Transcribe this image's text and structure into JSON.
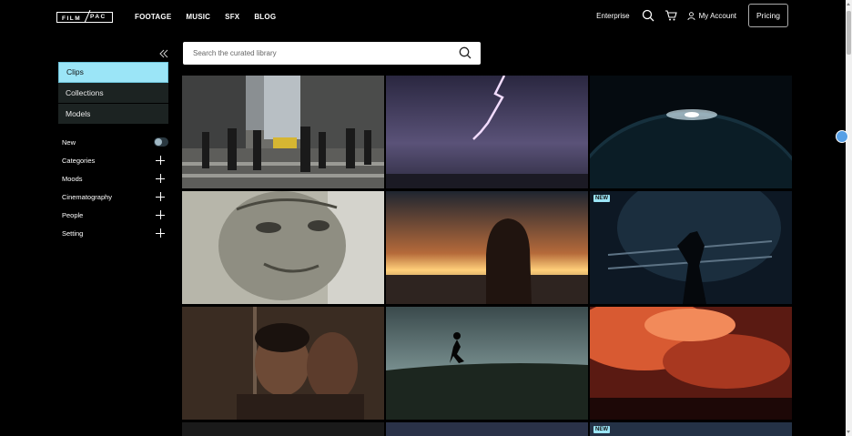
{
  "header": {
    "logo_text": "FILMPAC",
    "nav": [
      "FOOTAGE",
      "MUSIC",
      "SFX",
      "BLOG"
    ],
    "enterprise": "Enterprise",
    "account": "My Account",
    "pricing": "Pricing",
    "icons": [
      "search-icon",
      "cart-icon",
      "user-icon"
    ]
  },
  "sidebar": {
    "tabs": [
      "Clips",
      "Collections",
      "Models"
    ],
    "active_tab": "Clips",
    "new_label": "New",
    "filters": [
      "Categories",
      "Moods",
      "Cinematography",
      "People",
      "Setting"
    ]
  },
  "search": {
    "placeholder": "Search the curated library"
  },
  "grid": {
    "tiles": [
      {
        "name": "city-crosswalk-clip",
        "badge": ""
      },
      {
        "name": "lightning-storm-clip",
        "badge": ""
      },
      {
        "name": "planet-horizon-clip",
        "badge": ""
      },
      {
        "name": "dollar-bill-portrait-clip",
        "badge": ""
      },
      {
        "name": "woman-sunset-clip",
        "badge": ""
      },
      {
        "name": "boxer-shadow-clip",
        "badge": "NEW"
      },
      {
        "name": "mirror-man-clip",
        "badge": ""
      },
      {
        "name": "runner-hill-clip",
        "badge": ""
      },
      {
        "name": "red-clouds-clip",
        "badge": ""
      },
      {
        "name": "dark-clip-1",
        "badge": ""
      },
      {
        "name": "dark-clip-2",
        "badge": ""
      },
      {
        "name": "dark-clip-3",
        "badge": "NEW"
      }
    ]
  },
  "colors": {
    "accent": "#9be5f7",
    "sidebar_bg": "#1c2322",
    "page_bg": "#000000"
  }
}
